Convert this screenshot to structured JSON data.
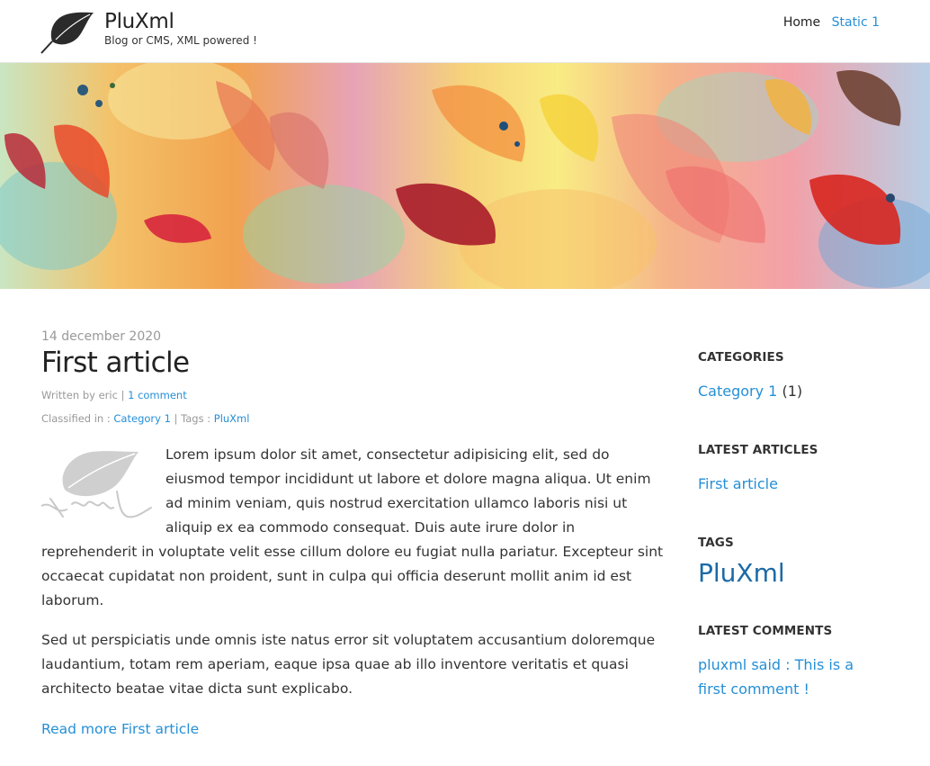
{
  "header": {
    "site_title": "PluXml",
    "site_description": "Blog or CMS, XML powered !",
    "nav": [
      {
        "label": "Home"
      },
      {
        "label": "Static 1"
      }
    ]
  },
  "article": {
    "date": "14 december 2020",
    "title": "First article",
    "written_by_prefix": "Written by eric",
    "separator": "|",
    "comments_link": "1 comment",
    "classified_prefix": "Classified in :",
    "category_link": "Category 1",
    "tags_prefix": "| Tags :",
    "tag_link": "PluXml",
    "paragraphs": [
      "Lorem ipsum dolor sit amet, consectetur adipisicing elit, sed do eiusmod tempor incididunt ut labore et dolore magna aliqua. Ut enim ad minim veniam, quis nostrud exercitation ullamco laboris nisi ut aliquip ex ea commodo consequat. Duis aute irure dolor in reprehenderit in voluptate velit esse cillum dolore eu fugiat nulla pariatur. Excepteur sint occaecat cupidatat non proident, sunt in culpa qui officia deserunt mollit anim id est laborum.",
      "Sed ut perspiciatis unde omnis iste natus error sit voluptatem accusantium doloremque laudantium, totam rem aperiam, eaque ipsa quae ab illo inventore veritatis et quasi architecto beatae vitae dicta sunt explicabo."
    ],
    "read_more": "Read more First article"
  },
  "sidebar": {
    "categories_heading": "CATEGORIES",
    "category_label": "Category 1",
    "category_count": "(1)",
    "latest_articles_heading": "LATEST ARTICLES",
    "latest_article": "First article",
    "tags_heading": "TAGS",
    "tag": "PluXml",
    "latest_comments_heading": "LATEST COMMENTS",
    "latest_comment": "pluxml said : This is a first comment !"
  },
  "colors": {
    "link": "#258fd6",
    "tag_link": "#1c6aa6",
    "text": "#333333",
    "muted": "#999999"
  }
}
